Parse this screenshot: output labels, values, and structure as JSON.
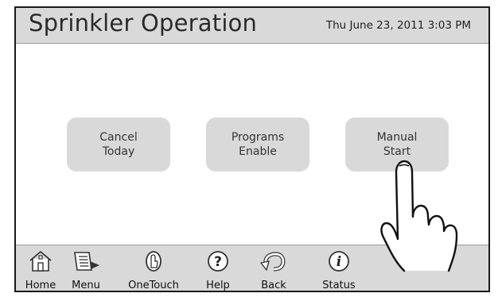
{
  "header": {
    "title": "Sprinkler Operation",
    "datetime": "Thu June 23, 2011  3:03 PM"
  },
  "buttons": {
    "cancel_today": {
      "line1": "Cancel",
      "line2": "Today"
    },
    "programs_enable": {
      "line1": "Programs",
      "line2": "Enable"
    },
    "manual_start": {
      "line1": "Manual",
      "line2": "Start"
    }
  },
  "nav": {
    "home": "Home",
    "menu": "Menu",
    "onetouch": "OneTouch",
    "help": "Help",
    "back": "Back",
    "status": "Status"
  },
  "icons": {
    "home": "home-icon",
    "menu": "menu-book-icon",
    "onetouch": "onetouch-icon",
    "help": "help-icon",
    "back": "back-arrow-icon",
    "status": "status-info-icon",
    "pointer": "pointing-hand-icon"
  },
  "colors": {
    "panel_gray": "#d9d9d9",
    "border": "#1a1a1a",
    "text": "#222222"
  }
}
